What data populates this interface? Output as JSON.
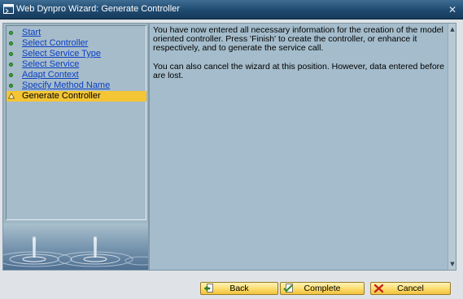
{
  "window": {
    "title": "Web Dynpro Wizard: Generate Controller",
    "close_symbol": "✕",
    "icon": "wizard-window-icon"
  },
  "steps": [
    {
      "label": "Start",
      "state": "done"
    },
    {
      "label": "Select Controller",
      "state": "done"
    },
    {
      "label": "Select Service Type",
      "state": "done"
    },
    {
      "label": "Select Service",
      "state": "done"
    },
    {
      "label": "Adapt Context",
      "state": "done"
    },
    {
      "label": "Specify Method Name",
      "state": "done"
    },
    {
      "label": "Generate Controller",
      "state": "current"
    }
  ],
  "content": {
    "paragraph1": "You have now entered all necessary information for the creation of the model oriented controller. Press 'Finish' to create the controller, or enhance it respectively, and to generate the service call.",
    "paragraph2": "You can also cancel the wizard at this position. However, data entered before are lost."
  },
  "scrollbar": {
    "up": "▲",
    "down": "▼"
  },
  "buttons": {
    "back": {
      "label": "Back",
      "icon": "back-page-icon"
    },
    "complete": {
      "label": "Complete",
      "icon": "checkmark-icon"
    },
    "cancel": {
      "label": "Cancel",
      "icon": "red-x-icon"
    }
  },
  "colors": {
    "titlebar": "#1f4a70",
    "panel": "#a4bccb",
    "link": "#0a3fc4",
    "active_step": "#f4c535",
    "done_bullet": "#3fa23a",
    "button": "#fbdb6c"
  }
}
